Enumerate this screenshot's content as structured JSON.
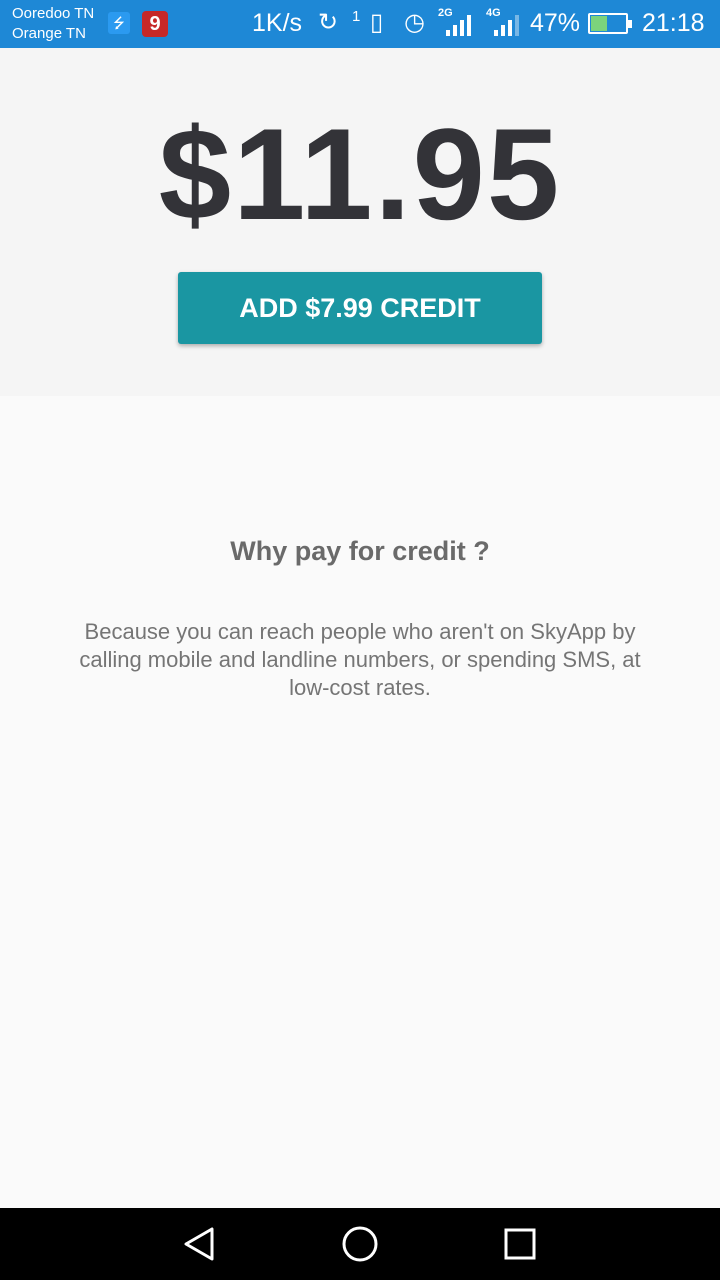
{
  "status_bar": {
    "carrier1": "Ooredoo TN",
    "carrier2": "Orange TN",
    "net_speed": "1K/s",
    "sync_count": "1",
    "net_2g": "2G",
    "net_4g": "4G",
    "battery_percent": "47%",
    "battery_level": 0.47,
    "time": "21:18",
    "notification_badge": "9"
  },
  "credit": {
    "balance": "$11.95",
    "add_button_label": "ADD $7.99 CREDIT"
  },
  "info": {
    "title": "Why pay for credit ?",
    "body": "Because you can reach people who aren't on SkyApp by calling mobile and landline numbers, or spending SMS, at low-cost rates."
  },
  "colors": {
    "status_bar": "#1e88d6",
    "accent_button": "#1a96a2",
    "balance_text": "#333338"
  },
  "icons": [
    "usb-icon",
    "notification-9-icon",
    "sync-icon",
    "vibrate-icon",
    "alarm-icon",
    "signal-icon",
    "battery-icon",
    "back-icon",
    "home-icon",
    "recents-icon"
  ]
}
